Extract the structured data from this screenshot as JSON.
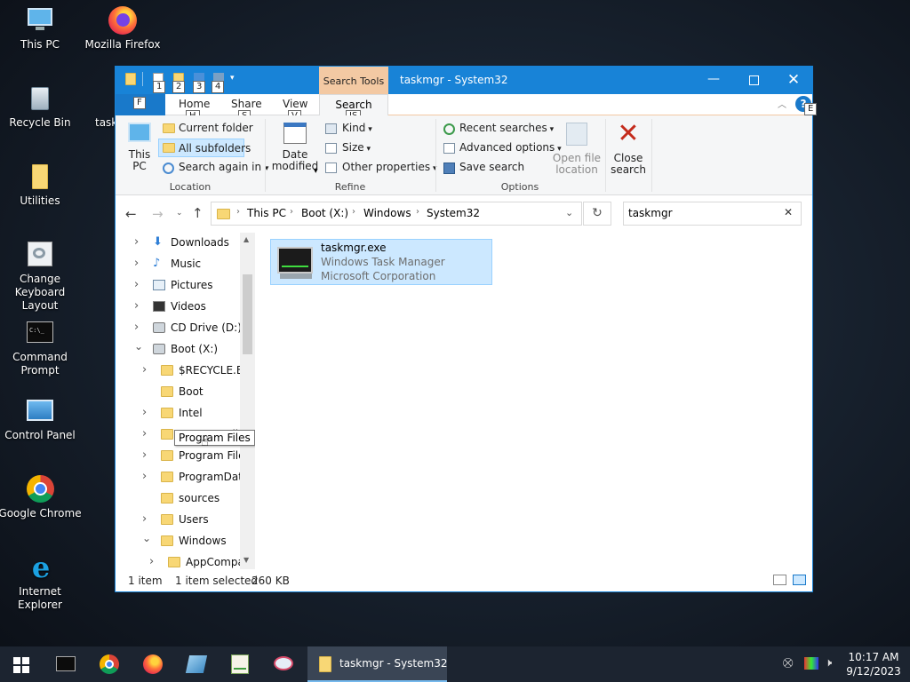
{
  "desktop": {
    "icons": [
      {
        "label": "This PC",
        "icon": "this-pc-icon"
      },
      {
        "label": "Mozilla Firefox",
        "icon": "firefox-icon"
      },
      {
        "label": "Recycle Bin",
        "icon": "recycle-bin-icon"
      },
      {
        "label": "task",
        "icon": "shortcut-icon"
      },
      {
        "label": "Utilities",
        "icon": "folder-icon"
      },
      {
        "label": "Change Keyboard Layout",
        "icon": "keyboard-icon"
      },
      {
        "label": "Command Prompt",
        "icon": "cmd-icon"
      },
      {
        "label": "Control Panel",
        "icon": "control-panel-icon"
      },
      {
        "label": "Google Chrome",
        "icon": "chrome-icon"
      },
      {
        "label": "Internet Explorer",
        "icon": "ie-icon"
      }
    ]
  },
  "window": {
    "title": "taskmgr - System32",
    "context_tab": "Search Tools",
    "qat_keytips": [
      "1",
      "2",
      "3",
      "4"
    ],
    "tabs": {
      "file": "F",
      "home": "Home",
      "home_key": "H",
      "share": "Share",
      "share_key": "S",
      "view": "View",
      "view_key": "V",
      "search": "Search",
      "search_key": "JS",
      "help_key": "E"
    },
    "ribbon": {
      "location": {
        "this_pc": "This PC",
        "current_folder": "Current folder",
        "all_subfolders": "All subfolders",
        "search_again": "Search again in",
        "label": "Location"
      },
      "refine": {
        "date_modified": "Date modified",
        "kind": "Kind",
        "size": "Size",
        "other_properties": "Other properties",
        "label": "Refine"
      },
      "options": {
        "recent_searches": "Recent searches",
        "advanced_options": "Advanced options",
        "save_search": "Save search",
        "open_file_location": "Open file location",
        "label": "Options"
      },
      "close_search": "Close search"
    },
    "address": {
      "crumbs": [
        "This PC",
        "Boot (X:)",
        "Windows",
        "System32"
      ],
      "search_value": "taskmgr"
    },
    "nav_tree": [
      {
        "label": "Downloads",
        "icon": "downloads-icon",
        "level": 1,
        "state": "collapsed"
      },
      {
        "label": "Music",
        "icon": "music-icon",
        "level": 1,
        "state": "collapsed"
      },
      {
        "label": "Pictures",
        "icon": "pictures-icon",
        "level": 1,
        "state": "collapsed"
      },
      {
        "label": "Videos",
        "icon": "videos-icon",
        "level": 1,
        "state": "collapsed"
      },
      {
        "label": "CD Drive (D:)",
        "icon": "cd-drive-icon",
        "level": 1,
        "state": "collapsed"
      },
      {
        "label": "Boot (X:)",
        "icon": "drive-icon",
        "level": 1,
        "state": "expanded"
      },
      {
        "label": "$RECYCLE.BIN",
        "icon": "folder-icon",
        "level": 2,
        "state": "collapsed"
      },
      {
        "label": "Boot",
        "icon": "folder-icon",
        "level": 2,
        "state": "none"
      },
      {
        "label": "Intel",
        "icon": "folder-icon",
        "level": 2,
        "state": "collapsed"
      },
      {
        "label": "Program Files",
        "icon": "folder-icon",
        "level": 2,
        "state": "collapsed"
      },
      {
        "label": "Program Files",
        "icon": "folder-icon",
        "level": 2,
        "state": "collapsed"
      },
      {
        "label": "ProgramData",
        "icon": "folder-icon",
        "level": 2,
        "state": "collapsed"
      },
      {
        "label": "sources",
        "icon": "folder-icon",
        "level": 2,
        "state": "none"
      },
      {
        "label": "Users",
        "icon": "folder-icon",
        "level": 2,
        "state": "collapsed"
      },
      {
        "label": "Windows",
        "icon": "folder-icon",
        "level": 2,
        "state": "expanded"
      },
      {
        "label": "AppCompat",
        "icon": "folder-icon",
        "level": 3,
        "state": "collapsed"
      }
    ],
    "tooltip": "Program Files",
    "result": {
      "name": "taskmgr.exe",
      "description": "Windows Task Manager",
      "company": "Microsoft Corporation"
    },
    "status": {
      "count": "1 item",
      "selected": "1 item selected",
      "size": "260 KB"
    }
  },
  "taskbar": {
    "active_window": "taskmgr - System32",
    "time": "10:17 AM",
    "date": "9/12/2023"
  },
  "colors": {
    "accent": "#1883d7",
    "selection": "#cce8ff",
    "taskbar": "#1c2430"
  }
}
